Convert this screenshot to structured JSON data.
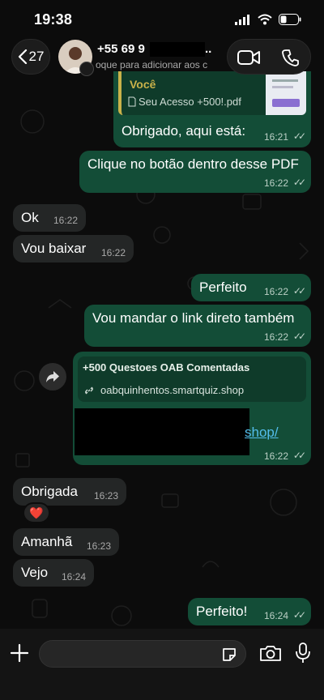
{
  "status": {
    "time": "19:38"
  },
  "header": {
    "back_count": "27",
    "contact_name": "+55 69 9",
    "contact_name_tail": "...",
    "contact_subtitle": "oque para adicionar aos c"
  },
  "messages": {
    "pdf_partial": {
      "heading": "Você",
      "file_name": "Seu Acesso +500!.pdf"
    },
    "m1": {
      "text": "Obrigado, aqui está:",
      "time": "16:21"
    },
    "m2": {
      "text": "Clique no botão dentro desse PDF",
      "time": "16:22"
    },
    "m3": {
      "text": "Ok",
      "time": "16:22"
    },
    "m4": {
      "text": "Vou baixar",
      "time": "16:22"
    },
    "m5": {
      "text": "Perfeito",
      "time": "16:22"
    },
    "m6": {
      "text": "Vou mandar o link direto também",
      "time": "16:22"
    },
    "m7": {
      "preview_title": "+500 Questoes OAB Comentadas",
      "preview_url": "oabquinhentos.smartquiz.shop",
      "link_tail": "shop/",
      "time": "16:22"
    },
    "m8": {
      "text": "Obrigada",
      "time": "16:23"
    },
    "m9": {
      "reaction": "❤️"
    },
    "m10": {
      "text": "Amanhã",
      "time": "16:23"
    },
    "m11": {
      "text": "Vejo",
      "time": "16:24"
    },
    "m12": {
      "text": "Perfeito!",
      "time": "16:24"
    }
  },
  "colors": {
    "outgoing": "#134d37",
    "incoming": "#242626",
    "background": "#0c0c0c"
  },
  "icons": [
    "chevron-left-icon",
    "video-call-icon",
    "phone-icon",
    "forward-icon",
    "link-icon",
    "plus-icon",
    "sticker-icon",
    "camera-icon",
    "microphone-icon",
    "pdf-icon"
  ]
}
